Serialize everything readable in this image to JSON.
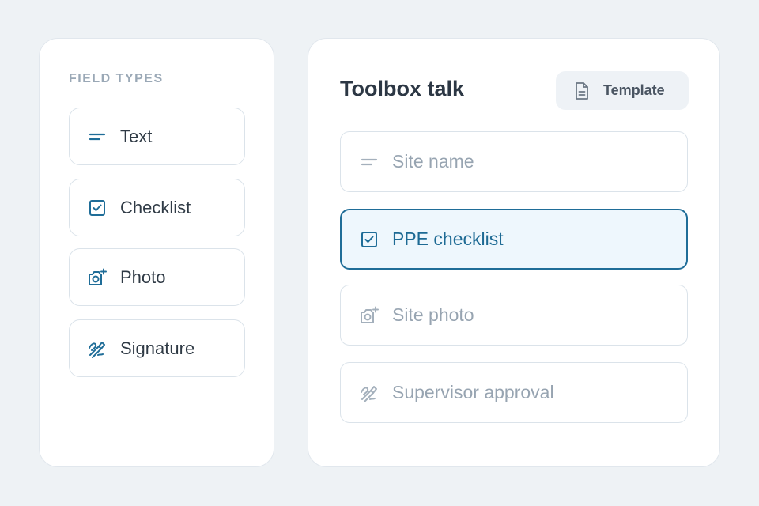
{
  "colors": {
    "background": "#eef2f5",
    "accent": "#1f6d98",
    "selected_fill": "#eef7fd",
    "muted_text": "#97a4b1"
  },
  "palette": {
    "heading": "FIELD TYPES",
    "items": [
      {
        "label": "Text",
        "icon": "text-lines-icon"
      },
      {
        "label": "Checklist",
        "icon": "checkbox-icon"
      },
      {
        "label": "Photo",
        "icon": "camera-icon"
      },
      {
        "label": "Signature",
        "icon": "signature-pen-icon"
      }
    ]
  },
  "form": {
    "title": "Toolbox talk",
    "template_button": {
      "label": "Template",
      "icon": "document-icon"
    },
    "fields": [
      {
        "label": "Site name",
        "icon": "text-lines-icon",
        "selected": false
      },
      {
        "label": "PPE checklist",
        "icon": "checkbox-icon",
        "selected": true
      },
      {
        "label": "Site photo",
        "icon": "camera-icon",
        "selected": false
      },
      {
        "label": "Supervisor approval",
        "icon": "signature-pen-icon",
        "selected": false
      }
    ]
  }
}
